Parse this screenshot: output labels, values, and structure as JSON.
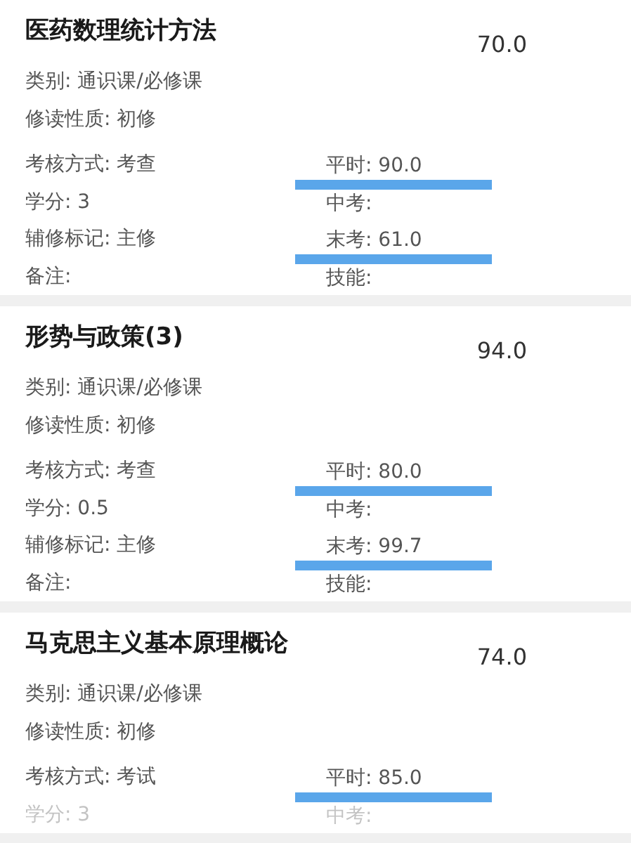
{
  "courses": [
    {
      "title": "医药数理统计方法",
      "score": "70.0",
      "rows": [
        {
          "faded": false,
          "left": {
            "text": "类别: 通识课/必修课"
          }
        },
        {
          "faded": false,
          "left": {
            "text": "修读性质: 初修"
          }
        },
        {
          "faded": false,
          "left": {
            "text": "考核方式: 考查"
          },
          "right": {
            "text": "平时: 90.0",
            "underlined": true
          }
        },
        {
          "faded": false,
          "left": {
            "text": "学分: 3"
          },
          "right": {
            "text": "中考:",
            "underlined": false
          }
        },
        {
          "faded": false,
          "left": {
            "text": "辅修标记: 主修"
          },
          "right": {
            "text": "末考: 61.0",
            "underlined": true
          }
        },
        {
          "faded": false,
          "left": {
            "text": "备注:"
          },
          "right": {
            "text": "技能:",
            "underlined": false
          }
        }
      ]
    },
    {
      "title": "形势与政策(3)",
      "score": "94.0",
      "rows": [
        {
          "faded": false,
          "left": {
            "text": "类别: 通识课/必修课"
          }
        },
        {
          "faded": false,
          "left": {
            "text": "修读性质: 初修"
          }
        },
        {
          "faded": false,
          "left": {
            "text": "考核方式: 考查"
          },
          "right": {
            "text": "平时: 80.0",
            "underlined": true
          }
        },
        {
          "faded": false,
          "left": {
            "text": "学分: 0.5"
          },
          "right": {
            "text": "中考:",
            "underlined": false
          }
        },
        {
          "faded": false,
          "left": {
            "text": "辅修标记: 主修"
          },
          "right": {
            "text": "末考: 99.7",
            "underlined": true
          }
        },
        {
          "faded": false,
          "left": {
            "text": "备注:"
          },
          "right": {
            "text": "技能:",
            "underlined": false
          }
        }
      ]
    },
    {
      "title": "马克思主义基本原理概论",
      "score": "74.0",
      "rows": [
        {
          "faded": false,
          "left": {
            "text": "类别: 通识课/必修课"
          }
        },
        {
          "faded": false,
          "left": {
            "text": "修读性质: 初修"
          }
        },
        {
          "faded": false,
          "left": {
            "text": "考核方式: 考试"
          },
          "right": {
            "text": "平时: 85.0",
            "underlined": true
          }
        },
        {
          "faded": true,
          "left": {
            "text": "学分: 3"
          },
          "right": {
            "text": "中考:",
            "underlined": false
          }
        }
      ]
    }
  ]
}
